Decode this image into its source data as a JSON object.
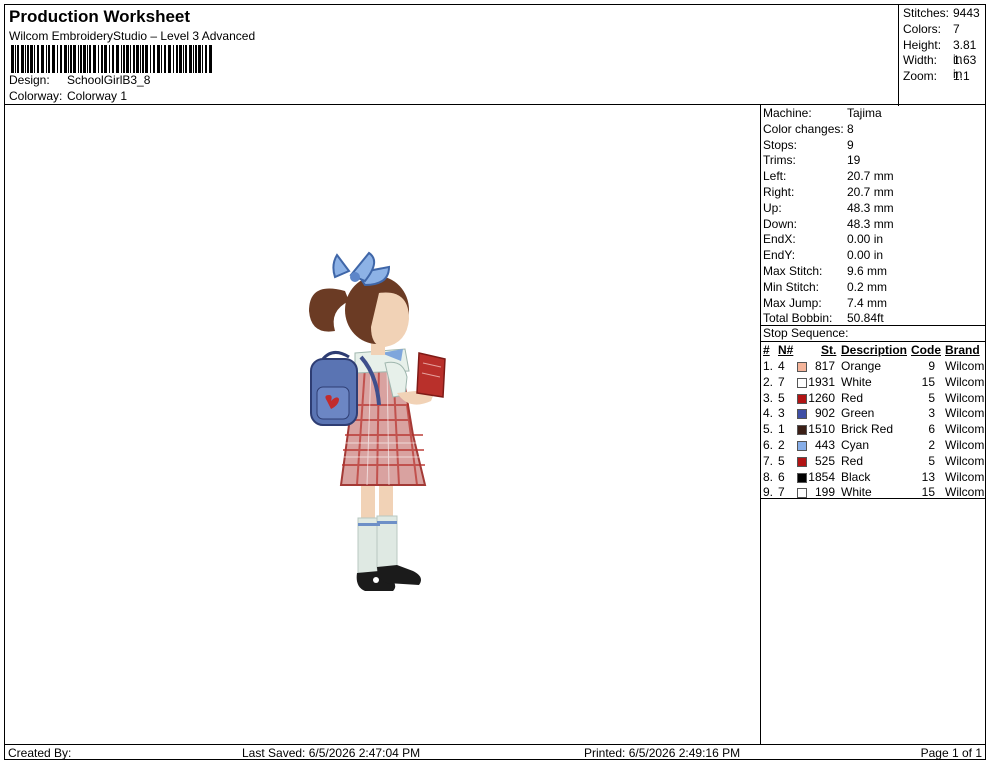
{
  "header": {
    "title": "Production Worksheet",
    "subtitle": "Wilcom EmbroideryStudio – Level 3 Advanced",
    "design_label": "Design:",
    "design_value": "SchoolGirlB3_8",
    "colorway_label": "Colorway:",
    "colorway_value": "Colorway 1"
  },
  "stats": [
    {
      "label": "Stitches:",
      "value": "9443"
    },
    {
      "label": "Colors:",
      "value": "7"
    },
    {
      "label": "Height:",
      "value": "3.81 in"
    },
    {
      "label": "Width:",
      "value": "1.63 in"
    },
    {
      "label": "Zoom:",
      "value": "1:1"
    }
  ],
  "machine_info": [
    {
      "label": "Machine:",
      "value": "Tajima"
    },
    {
      "label": "Color changes:",
      "value": "8"
    },
    {
      "label": "Stops:",
      "value": "9"
    },
    {
      "label": "Trims:",
      "value": "19"
    },
    {
      "label": "Left:",
      "value": "20.7 mm"
    },
    {
      "label": "Right:",
      "value": "20.7 mm"
    },
    {
      "label": "Up:",
      "value": "48.3 mm"
    },
    {
      "label": "Down:",
      "value": "48.3 mm"
    },
    {
      "label": "EndX:",
      "value": "0.00 in"
    },
    {
      "label": "EndY:",
      "value": "0.00 in"
    },
    {
      "label": "Max Stitch:",
      "value": "9.6 mm"
    },
    {
      "label": "Min Stitch:",
      "value": "0.2 mm"
    },
    {
      "label": "Max Jump:",
      "value": "7.4 mm"
    },
    {
      "label": "Total Bobbin:",
      "value": "50.84ft"
    }
  ],
  "stop_sequence": {
    "title": "Stop Sequence:",
    "headers": {
      "num": "#",
      "n": "N#",
      "st": "St.",
      "description": "Description",
      "code": "Code",
      "brand": "Brand"
    },
    "rows": [
      {
        "num": "1.",
        "n": "4",
        "color": "#f4b49a",
        "st": "817",
        "description": "Orange",
        "code": "9",
        "brand": "Wilcom"
      },
      {
        "num": "2.",
        "n": "7",
        "color": "#ffffff",
        "st": "1931",
        "description": "White",
        "code": "15",
        "brand": "Wilcom"
      },
      {
        "num": "3.",
        "n": "5",
        "color": "#b21414",
        "st": "1260",
        "description": "Red",
        "code": "5",
        "brand": "Wilcom"
      },
      {
        "num": "4.",
        "n": "3",
        "color": "#3f4fa6",
        "st": "902",
        "description": "Green",
        "code": "3",
        "brand": "Wilcom"
      },
      {
        "num": "5.",
        "n": "1",
        "color": "#3b1f16",
        "st": "1510",
        "description": "Brick Red",
        "code": "6",
        "brand": "Wilcom"
      },
      {
        "num": "6.",
        "n": "2",
        "color": "#87aee8",
        "st": "443",
        "description": "Cyan",
        "code": "2",
        "brand": "Wilcom"
      },
      {
        "num": "7.",
        "n": "5",
        "color": "#b21414",
        "st": "525",
        "description": "Red",
        "code": "5",
        "brand": "Wilcom"
      },
      {
        "num": "8.",
        "n": "6",
        "color": "#000000",
        "st": "1854",
        "description": "Black",
        "code": "13",
        "brand": "Wilcom"
      },
      {
        "num": "9.",
        "n": "7",
        "color": "#ffffff",
        "st": "199",
        "description": "White",
        "code": "15",
        "brand": "Wilcom"
      }
    ]
  },
  "footer": {
    "created_by": "Created By:",
    "last_saved": "Last Saved: 6/5/2026 2:47:04 PM",
    "printed": "Printed: 6/5/2026 2:49:16 PM",
    "page": "Page 1 of 1"
  }
}
